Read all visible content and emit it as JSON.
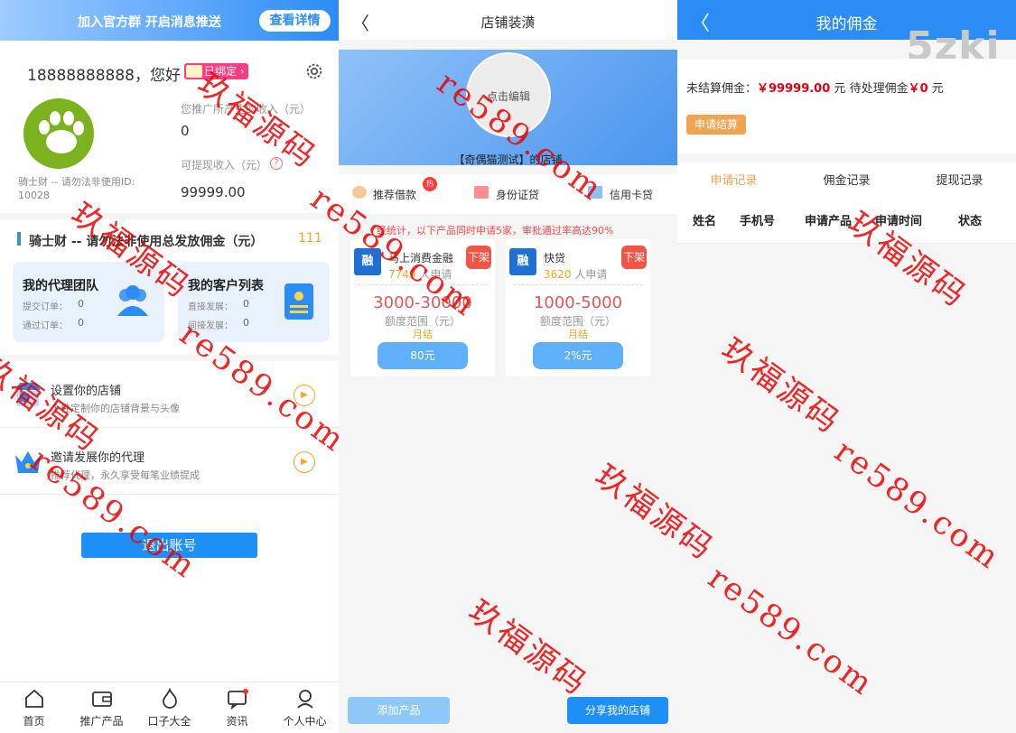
{
  "home": {
    "banner_text": "加入官方群 开启消息推送",
    "banner_button": "查看详情",
    "greeting": "18888888888，您好",
    "bound_badge": "已绑定 ›",
    "user_line": "骑士财 -- 请勿法非使用ID:",
    "user_id": "10028",
    "promo_income_label": "您推广所产生的收入（元）",
    "promo_income_value": "0",
    "withdrawable_label": "可提现收入（元）",
    "withdrawable_value": "99999.00",
    "commission_title": "骑士财 -- 请勿法非使用总发放佣金（元）",
    "commission_value": "111",
    "agent_card": {
      "title": "我的代理团队",
      "l1": "提交订单：",
      "v1": "0",
      "l2": "通过订单：",
      "v2": "0"
    },
    "client_card": {
      "title": "我的客户列表",
      "l1": "直接发展：",
      "v1": "0",
      "l2": "间接发展：",
      "v2": "0"
    },
    "menu": [
      {
        "title": "设置你的店铺",
        "sub": "个性定制你的店铺背景与头像"
      },
      {
        "title": "邀请发展你的代理",
        "sub": "推荐代理，永久享受每笔业绩提成"
      }
    ],
    "logout": "退出账号",
    "tabs": [
      "首页",
      "推广产品",
      "口子大全",
      "资讯",
      "个人中心"
    ]
  },
  "shop": {
    "title": "店铺装潢",
    "avatar_hint": "点击编辑",
    "shop_name": "【奇偶猫测试】的店铺",
    "categories": [
      "推荐借款",
      "身份证贷",
      "信用卡贷"
    ],
    "hot_badge": "热",
    "notice": "经统计，以下产品同时申请5家，审批通过率高达90%",
    "products": [
      {
        "logo": "融",
        "name": "马上消费金融",
        "count": "7749",
        "count_suffix": "人申请",
        "off": "下架",
        "range": "3000-30000",
        "range_label": "额度范围（元）",
        "method": "月结",
        "button": "80元"
      },
      {
        "logo": "融",
        "name": "快贷",
        "count": "3620",
        "count_suffix": "人申请",
        "off": "下架",
        "range": "1000-5000",
        "range_label": "额度范围（元）",
        "method": "月结",
        "button": "2%元"
      }
    ],
    "add_button": "添加产品",
    "share_button": "分享我的店铺"
  },
  "commission": {
    "title": "我的佣金",
    "brand": "5zki",
    "unsettled_label": "未结算佣金：",
    "unsettled_value": "￥99999.00",
    "unit": "元",
    "pending_label": "待处理佣金",
    "pending_value": "￥0",
    "apply_button": "申请结算",
    "tabs": [
      "申请记录",
      "佣金记录",
      "提现记录"
    ],
    "columns": [
      "姓名",
      "手机号",
      "申请产品",
      "申请时间",
      "状态"
    ]
  },
  "watermark": {
    "cn": "玖福源码",
    "url": "re589.com"
  },
  "colors": {
    "primary": "#2b8cf6",
    "accent": "#f0a350",
    "danger": "#e4000f",
    "badge": "#ff3c82"
  }
}
